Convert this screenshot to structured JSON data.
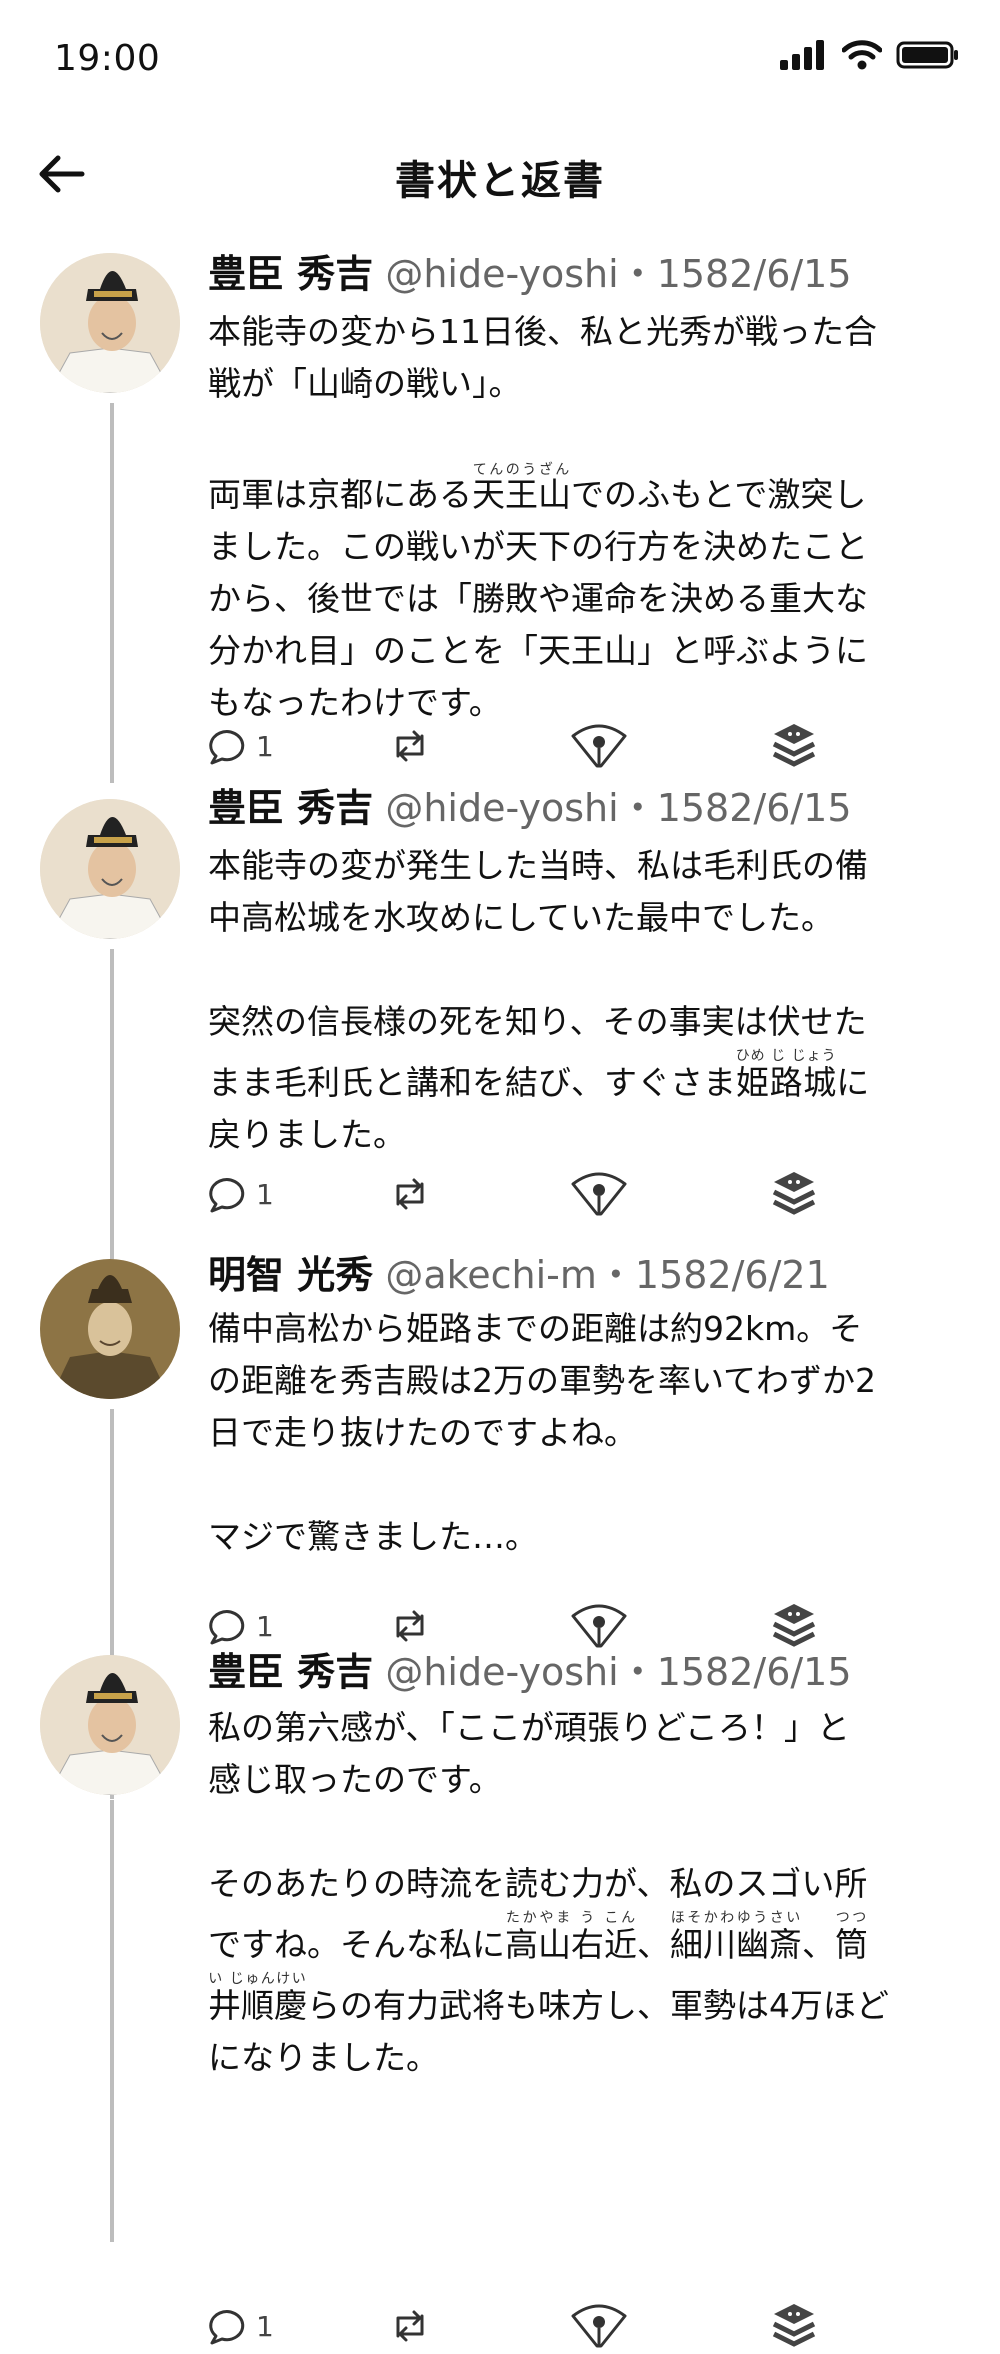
{
  "status_bar": {
    "time": "19:00"
  },
  "header": {
    "title": "書状と返書"
  },
  "posts": [
    {
      "name": "豊臣 秀吉",
      "handle": "@hide-yoshi・1582/6/15",
      "p1": [
        "本能寺の変から11日後、私と光秀が戦った合",
        "戦が「山崎の戦い」。"
      ],
      "p2_pre": "両軍は京都にある",
      "p2_ruby": "天王山",
      "p2_ruby_rt": "てんのうざん",
      "p2_post": "でのふもとで激突し",
      "p2_lines": [
        "ました。この戦いが天下の行方を決めたこと",
        "から、後世では「勝敗や運命を決める重大な",
        "分かれ目」のことを「天王山」と呼ぶように",
        "もなったわけです。"
      ],
      "reply_count": "1"
    },
    {
      "name": "豊臣 秀吉",
      "handle": "@hide-yoshi・1582/6/15",
      "p1": [
        "本能寺の変が発生した当時、私は毛利氏の備",
        "中高松城を水攻めにしていた最中でした。"
      ],
      "p2_line1": "突然の信長様の死を知り、その事実は伏せた",
      "p2_pre": "まま毛利氏と講和を結び、すぐさま",
      "p2_ruby": "姫路城",
      "p2_ruby_rt": "ひめ じ じょう",
      "p2_post": "に",
      "p2_last": "戻りました。",
      "reply_count": "1"
    },
    {
      "name": "明智 光秀",
      "handle": "@akechi-m・1582/6/21",
      "p1": [
        "備中高松から姫路までの距離は約92km。そ",
        "の距離を秀吉殿は2万の軍勢を率いてわずか2",
        "日で走り抜けたのですよね。"
      ],
      "p2": "マジで驚きました…。",
      "reply_count": "1"
    },
    {
      "name": "豊臣 秀吉",
      "handle": "@hide-yoshi・1582/6/15",
      "p1": [
        "私の第六感が、「ここが頑張りどころ！」と",
        "感じ取ったのです。"
      ],
      "p2_line1": "そのあたりの時流を読む力が、私のスゴい所",
      "p2_l2_pre": "ですね。そんな私に",
      "p2_l2_ruby1": "高山右近",
      "p2_l2_ruby1_rt": "たかやま う こん",
      "p2_l2_mid": "、",
      "p2_l2_ruby2": "細川幽斎",
      "p2_l2_ruby2_rt": "ほそかわゆうさい",
      "p2_l2_mid2": "、",
      "p2_l2_ruby3": "筒",
      "p2_l2_ruby3_rt": "つつ",
      "p2_l3_ruby": "井順慶",
      "p2_l3_ruby_rt": "い じゅんけい",
      "p2_l3_post": "らの有力武将も味方し、軍勢は4万ほど",
      "p2_last": "になりました。",
      "reply_count": "1"
    }
  ],
  "icons": [
    "back-arrow-icon",
    "signal-icon",
    "wifi-icon",
    "battery-icon",
    "reply-icon",
    "repost-icon",
    "fan-icon",
    "stack-icon"
  ]
}
